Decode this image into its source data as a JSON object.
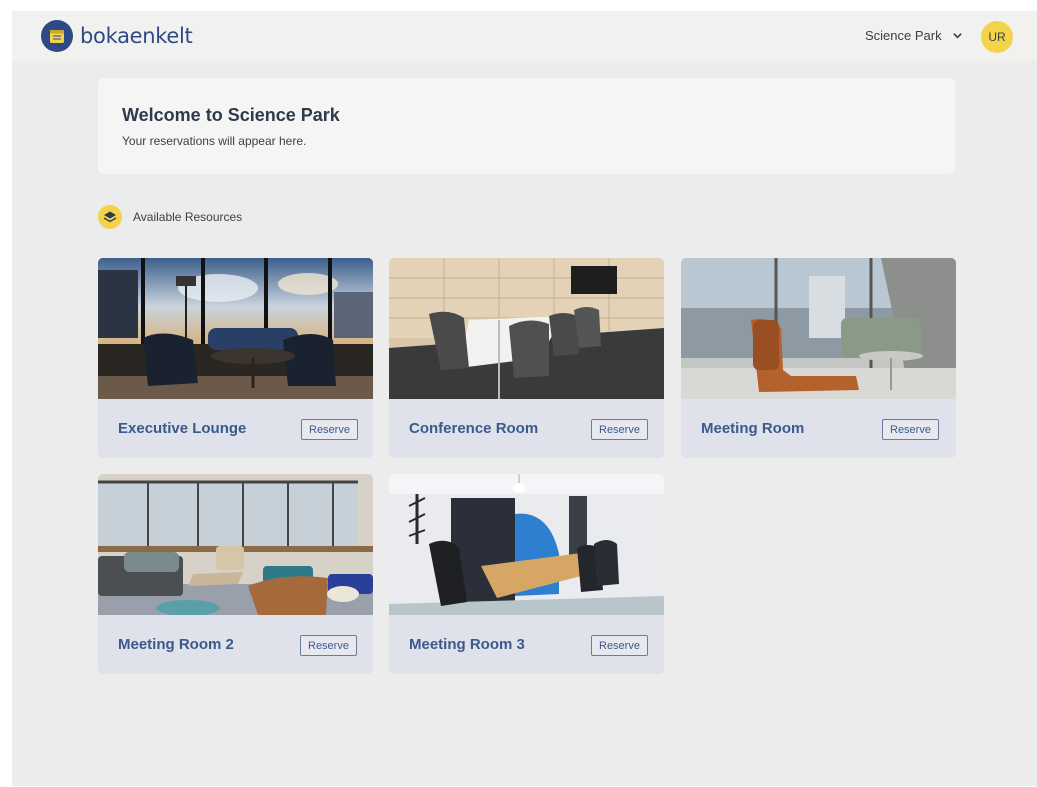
{
  "header": {
    "brand": "bokaenkelt",
    "org_selector": "Science Park",
    "avatar_initials": "UR"
  },
  "welcome": {
    "title": "Welcome to Science Park",
    "subtitle": "Your reservations will appear here."
  },
  "resources": {
    "heading": "Available Resources",
    "items": [
      {
        "name": "Executive Lounge",
        "action": "Reserve"
      },
      {
        "name": "Conference Room",
        "action": "Reserve"
      },
      {
        "name": "Meeting Room",
        "action": "Reserve"
      },
      {
        "name": "Meeting Room 2",
        "action": "Reserve"
      },
      {
        "name": "Meeting Room 3",
        "action": "Reserve"
      }
    ]
  },
  "colors": {
    "brand": "#2e4a86",
    "accent": "#f3d34a",
    "card_label": "#3b5a8c"
  }
}
